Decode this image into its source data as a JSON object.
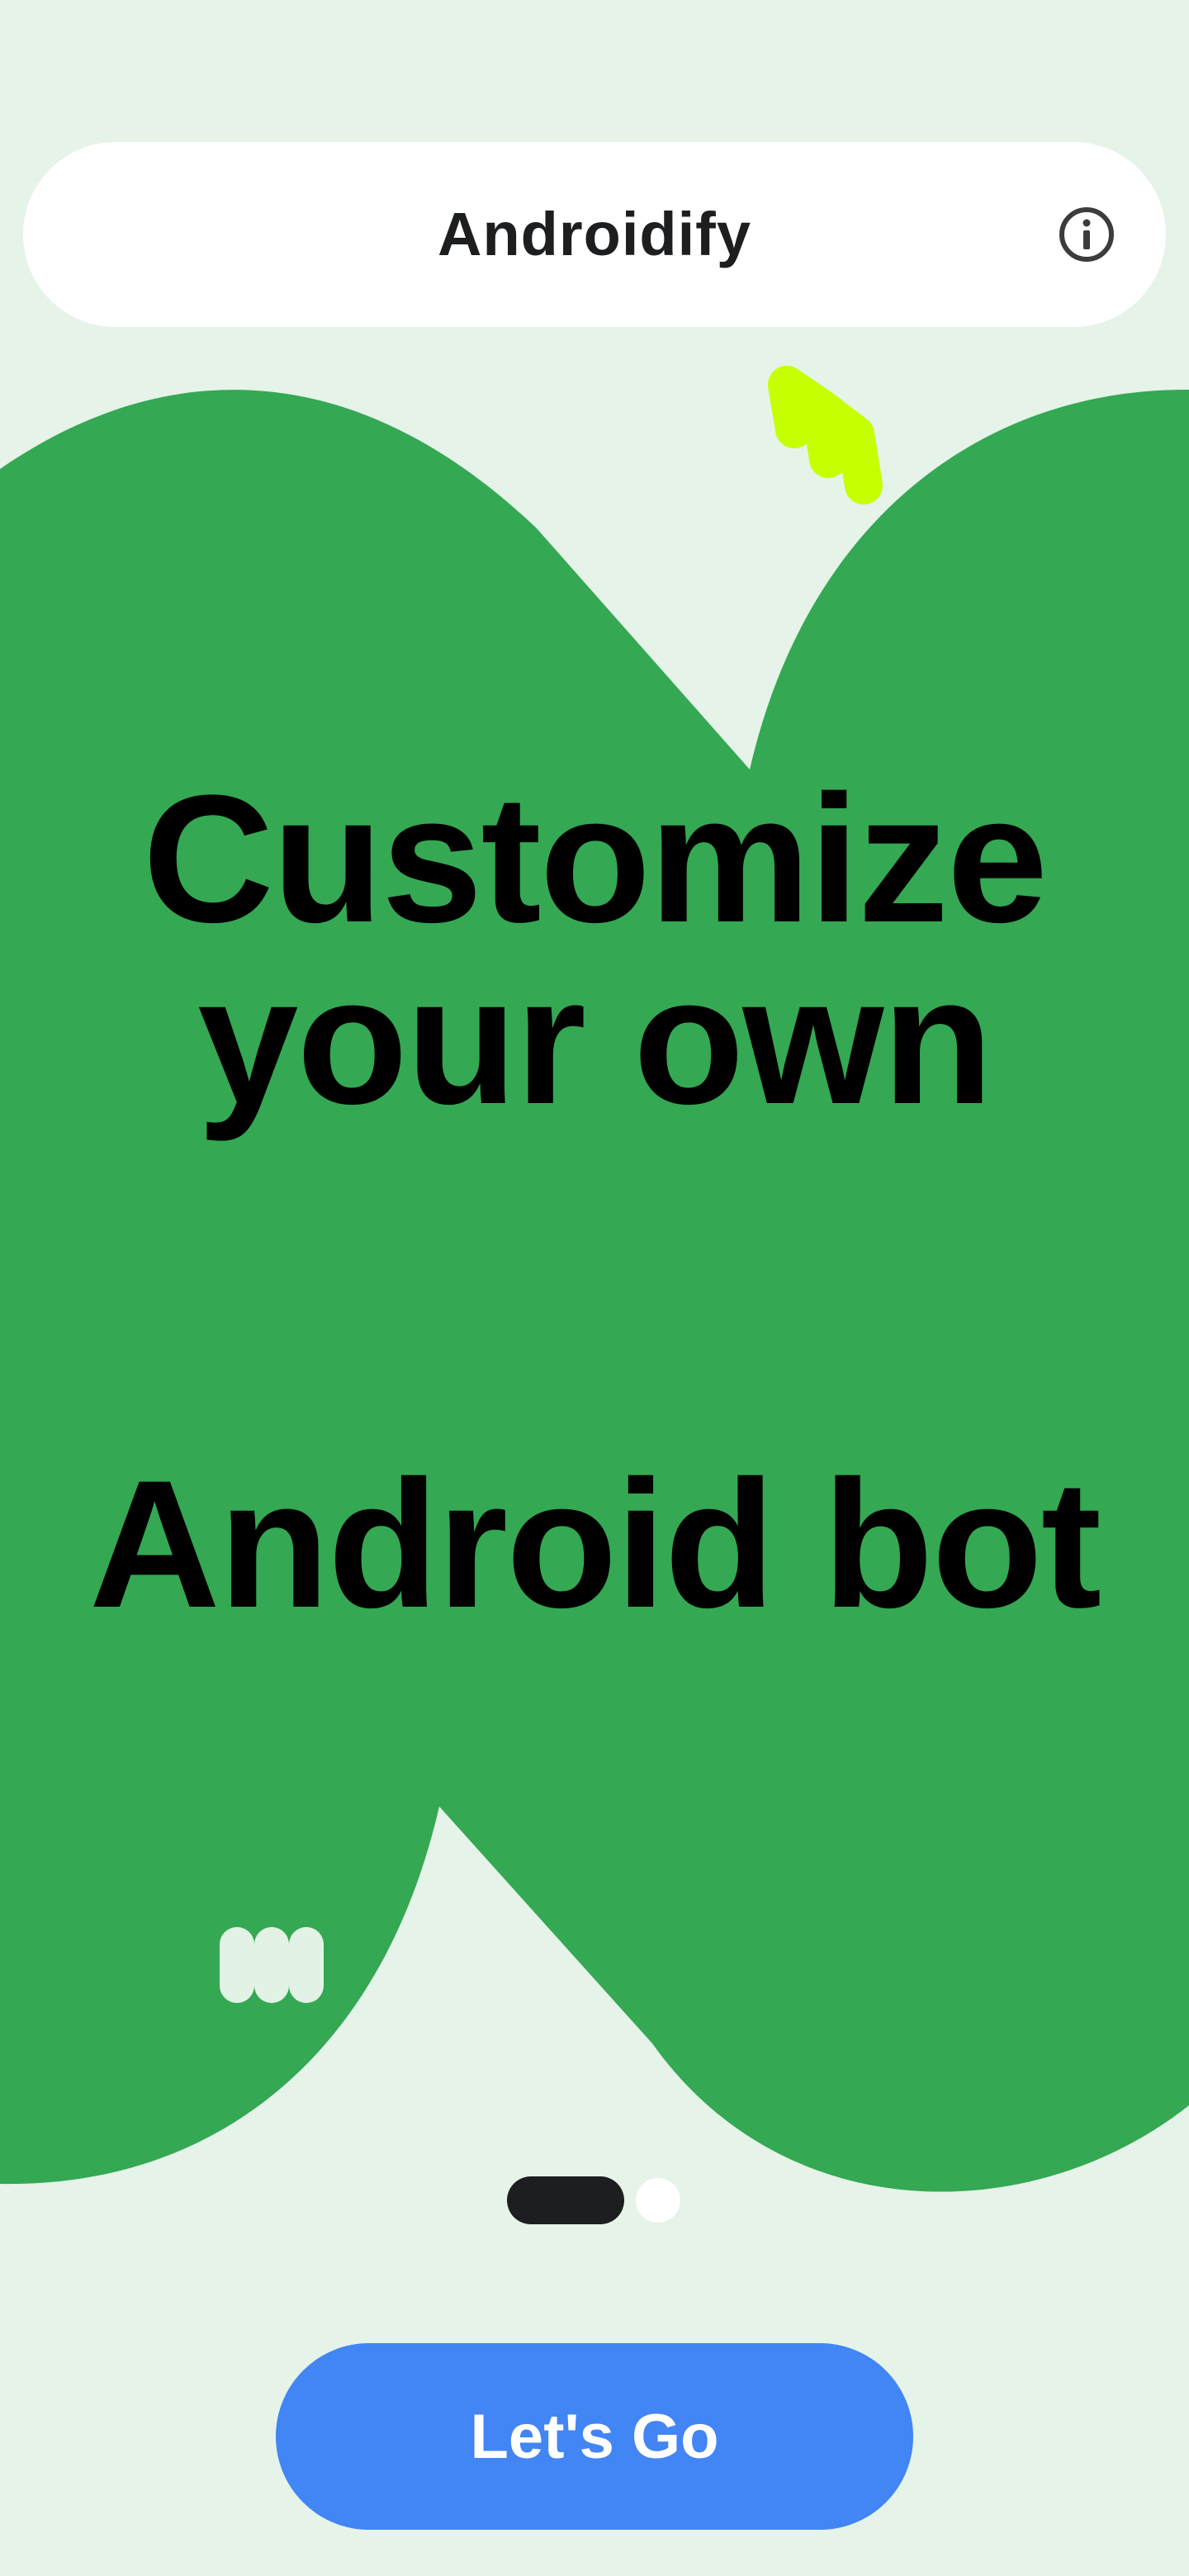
{
  "app_bar": {
    "title": "Androidify",
    "info_icon": "info-icon"
  },
  "hero": {
    "headline_line_1": "Customize",
    "headline_line_2": "your own",
    "headline_line_3": "Android bot",
    "shape_color": "#34a853",
    "accent_squiggle_color": "#c6ff00",
    "decor_squiggle_color": "#e2f3e6"
  },
  "pager": {
    "current_page": 1,
    "total_pages": 2
  },
  "cta": {
    "label": "Let's Go",
    "color": "#4285f4"
  },
  "colors": {
    "background": "#e5f3e9",
    "surface": "#ffffff",
    "on_surface": "#1d1e20"
  }
}
